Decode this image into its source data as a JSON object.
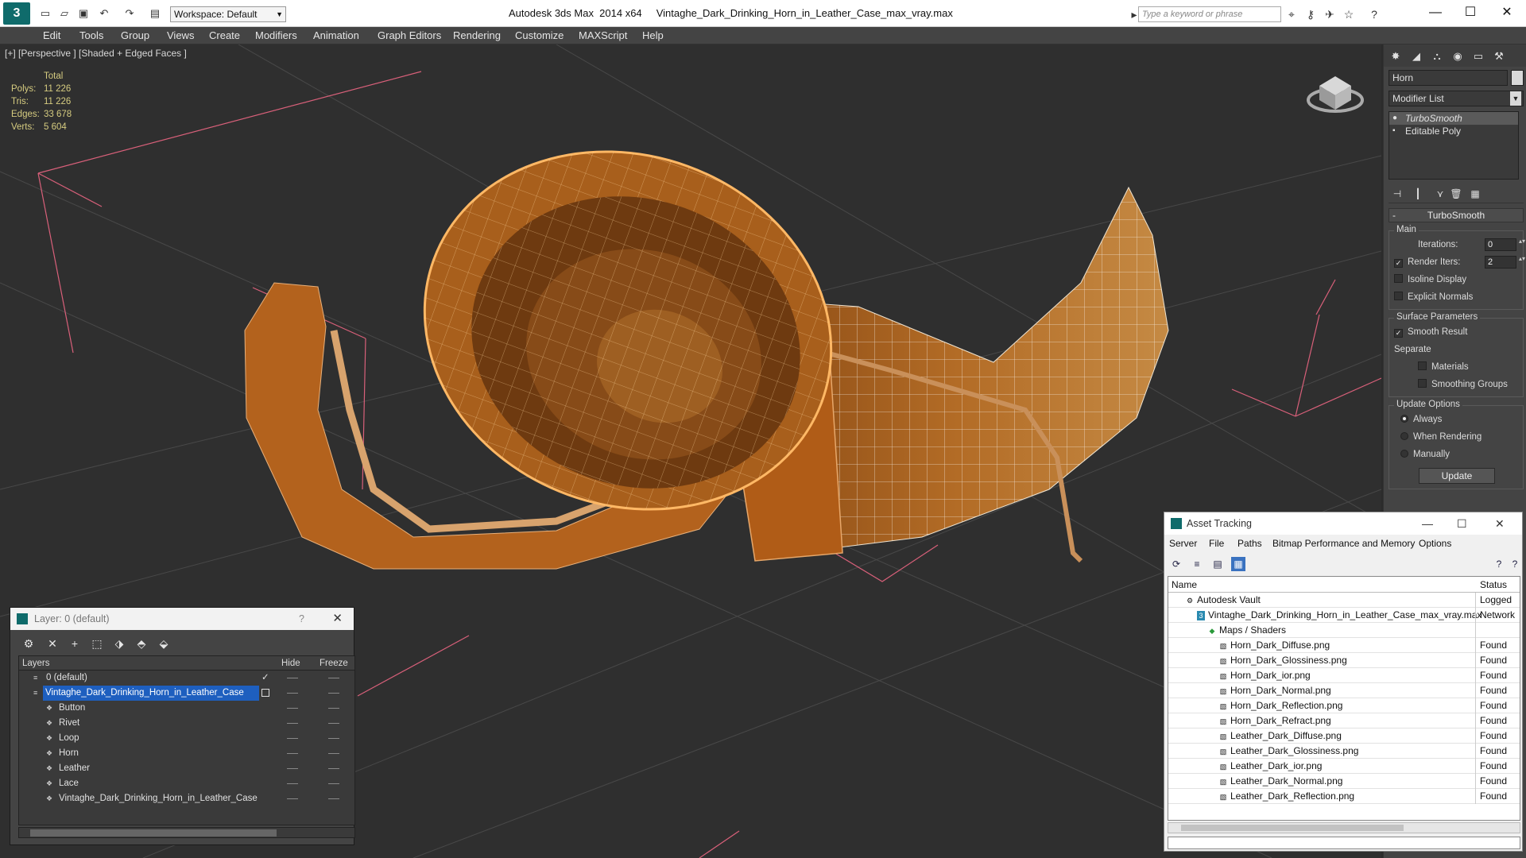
{
  "app": {
    "title": "Autodesk 3ds Max  2014 x64     Vintaghe_Dark_Drinking_Horn_in_Leather_Case_max_vray.max",
    "workspace": "Workspace: Default",
    "search_placeholder": "Type a keyword or phrase"
  },
  "menu": [
    "Edit",
    "Tools",
    "Group",
    "Views",
    "Create",
    "Modifiers",
    "Animation",
    "Graph Editors",
    "Rendering",
    "Customize",
    "MAXScript",
    "Help"
  ],
  "viewport": {
    "label": "[+] [Perspective ] [Shaded + Edged Faces ]",
    "stats": {
      "total_label": "Total",
      "rows": [
        {
          "k": "Polys:",
          "v": "11 226"
        },
        {
          "k": "Tris:",
          "v": "11 226"
        },
        {
          "k": "Edges:",
          "v": "33 678"
        },
        {
          "k": "Verts:",
          "v": "5 604"
        }
      ]
    }
  },
  "command_panel": {
    "object_name": "Horn",
    "modifier_list": "Modifier List",
    "stack": [
      "TurboSmooth",
      "Editable Poly"
    ],
    "rollout_title": "TurboSmooth",
    "main_group": "Main",
    "iterations_label": "Iterations:",
    "iterations_value": "0",
    "render_iters_label": "Render Iters:",
    "render_iters_value": "2",
    "isoline": "Isoline Display",
    "explicit_normals": "Explicit Normals",
    "surface_group": "Surface Parameters",
    "smooth_result": "Smooth Result",
    "separate": "Separate",
    "materials": "Materials",
    "smoothing_groups": "Smoothing Groups",
    "update_group": "Update Options",
    "always": "Always",
    "when_rendering": "When Rendering",
    "manually": "Manually",
    "update_btn": "Update"
  },
  "layer_dialog": {
    "title": "Layer: 0 (default)",
    "help": "?",
    "col_layers": "Layers",
    "col_hide": "Hide",
    "col_freeze": "Freeze",
    "rows": [
      {
        "name": "0 (default)"
      },
      {
        "name": "Vintaghe_Dark_Drinking_Horn_in_Leather_Case"
      },
      {
        "name": "Button"
      },
      {
        "name": "Rivet"
      },
      {
        "name": "Loop"
      },
      {
        "name": "Horn"
      },
      {
        "name": "Leather"
      },
      {
        "name": "Lace"
      },
      {
        "name": "Vintaghe_Dark_Drinking_Horn_in_Leather_Case"
      }
    ]
  },
  "asset_dialog": {
    "title": "Asset Tracking",
    "menu": [
      "Server",
      "File",
      "Paths",
      "Bitmap Performance and Memory",
      "Options"
    ],
    "col_name": "Name",
    "col_status": "Status",
    "rows": [
      {
        "name": "Autodesk Vault",
        "status": "Logged"
      },
      {
        "name": "Vintaghe_Dark_Drinking_Horn_in_Leather_Case_max_vray.max",
        "status": "Network"
      },
      {
        "name": "Maps / Shaders",
        "status": ""
      },
      {
        "name": "Horn_Dark_Diffuse.png",
        "status": "Found"
      },
      {
        "name": "Horn_Dark_Glossiness.png",
        "status": "Found"
      },
      {
        "name": "Horn_Dark_ior.png",
        "status": "Found"
      },
      {
        "name": "Horn_Dark_Normal.png",
        "status": "Found"
      },
      {
        "name": "Horn_Dark_Reflection.png",
        "status": "Found"
      },
      {
        "name": "Horn_Dark_Refract.png",
        "status": "Found"
      },
      {
        "name": "Leather_Dark_Diffuse.png",
        "status": "Found"
      },
      {
        "name": "Leather_Dark_Glossiness.png",
        "status": "Found"
      },
      {
        "name": "Leather_Dark_ior.png",
        "status": "Found"
      },
      {
        "name": "Leather_Dark_Normal.png",
        "status": "Found"
      },
      {
        "name": "Leather_Dark_Reflection.png",
        "status": "Found"
      }
    ]
  },
  "colors": {
    "viewport_bg": "#2f2f2f",
    "horn": "#b0651e",
    "leather": "#c0661c",
    "grid_line": "#d9607a",
    "selection": "#1e5fbf"
  }
}
